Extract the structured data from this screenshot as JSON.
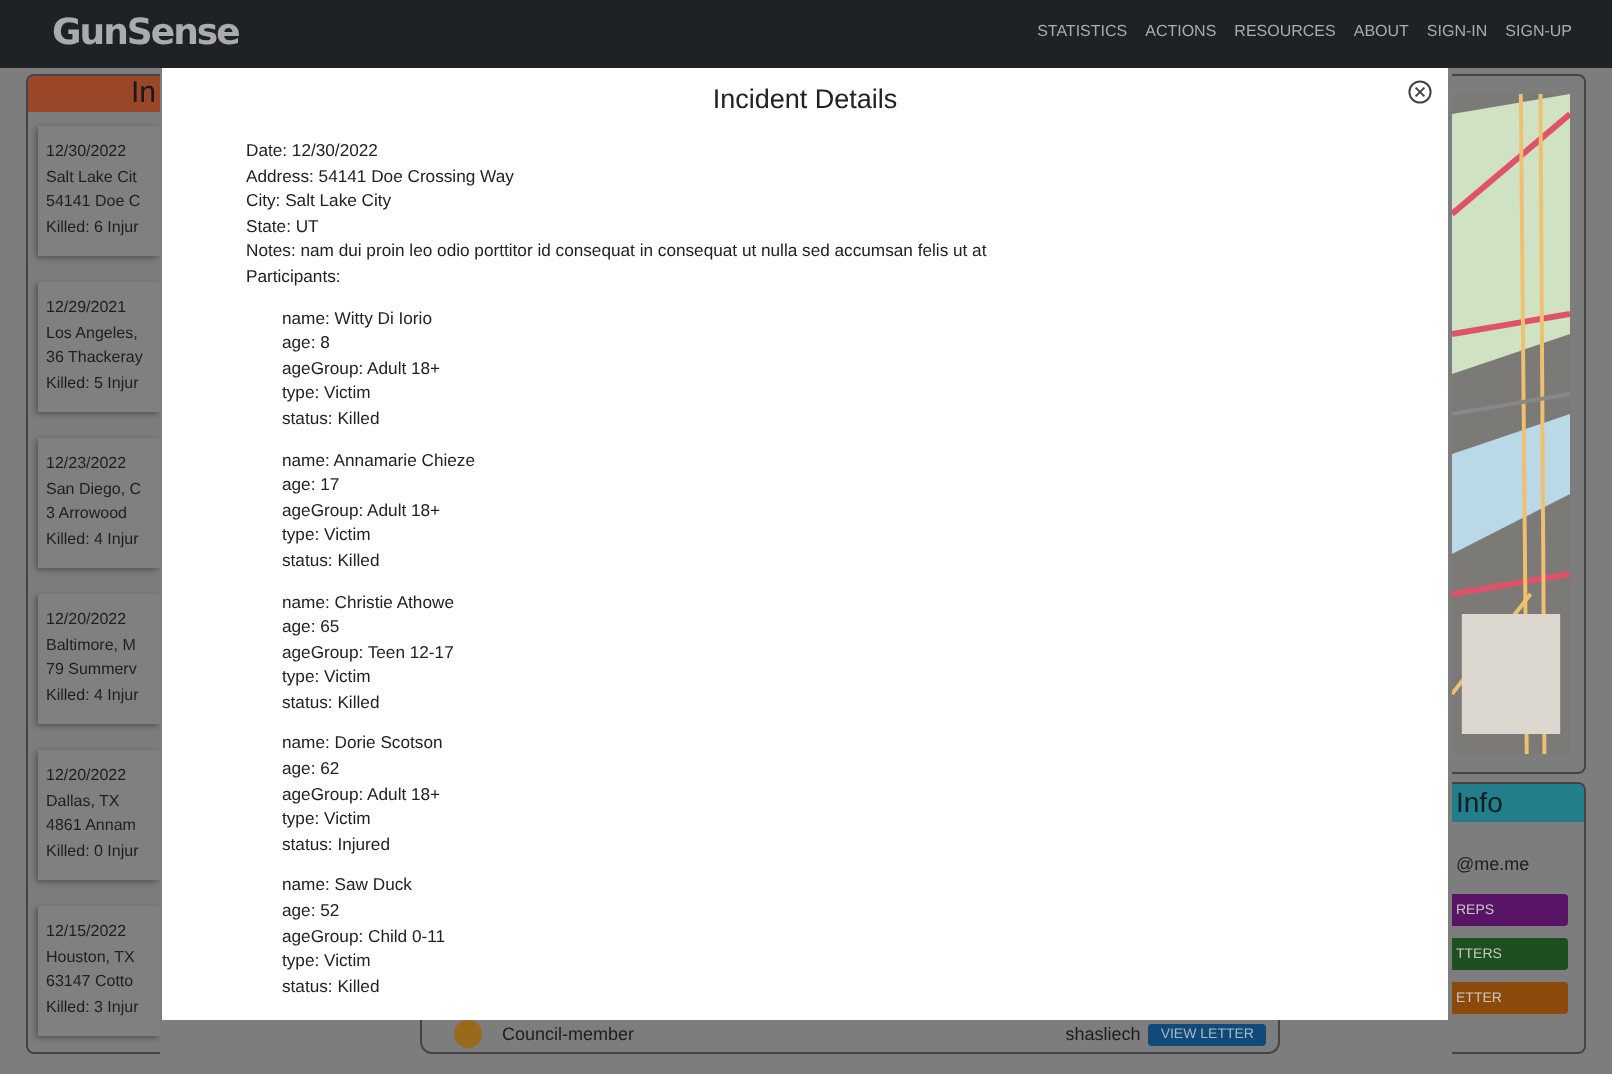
{
  "header": {
    "logo": "GunSense",
    "nav": [
      "STATISTICS",
      "ACTIONS",
      "RESOURCES",
      "ABOUT",
      "SIGN-IN",
      "SIGN-UP"
    ]
  },
  "incidents_panel": {
    "title": "In",
    "cards": [
      {
        "lines": [
          "12/30/2022",
          "Salt Lake Cit",
          "54141 Doe C",
          "Killed: 6 Injur"
        ]
      },
      {
        "lines": [
          "12/29/2021",
          "Los Angeles,",
          "36 Thackeray",
          "Killed: 5 Injur"
        ]
      },
      {
        "lines": [
          "12/23/2022",
          "San Diego, C",
          "3 Arrowood",
          "Killed: 4 Injur"
        ]
      },
      {
        "lines": [
          "12/20/2022",
          "Baltimore, M",
          "79 Summerv",
          "Killed: 4 Injur"
        ]
      },
      {
        "lines": [
          "12/20/2022",
          "Dallas, TX",
          "4861 Annam",
          "Killed: 0 Injur"
        ]
      },
      {
        "lines": [
          "12/15/2022",
          "Houston, TX",
          "63147 Cotto",
          "Killed: 3 Injur"
        ]
      }
    ]
  },
  "reps_row": {
    "role": "Council-member",
    "email": "shasliech",
    "button": "VIEW LETTER"
  },
  "info_panel": {
    "title": "Info",
    "email": "@me.me",
    "buttons": [
      {
        "label": "REPS",
        "color": "#5a1466"
      },
      {
        "label": "TTERS",
        "color": "#1d4f20"
      },
      {
        "label": "ETTER",
        "color": "#8c4a0a"
      }
    ]
  },
  "modal": {
    "title": "Incident Details",
    "details": [
      "Date: 12/30/2022",
      "Address: 54141 Doe Crossing Way",
      "City: Salt Lake City",
      "State: UT",
      "Notes: nam dui proin leo odio porttitor id consequat in consequat ut nulla sed accumsan felis ut at",
      "Participants:"
    ],
    "participants": [
      {
        "lines": [
          "name: Witty Di Iorio",
          "age: 8",
          "ageGroup: Adult 18+",
          "type: Victim",
          "status: Killed"
        ]
      },
      {
        "lines": [
          "name: Annamarie Chieze",
          "age: 17",
          "ageGroup: Adult 18+",
          "type: Victim",
          "status: Killed"
        ]
      },
      {
        "lines": [
          "name: Christie Athowe",
          "age: 65",
          "ageGroup: Teen 12-17",
          "type: Victim",
          "status: Killed"
        ]
      },
      {
        "lines": [
          "name: Dorie Scotson",
          "age: 62",
          "ageGroup: Adult 18+",
          "type: Victim",
          "status: Injured"
        ]
      },
      {
        "lines": [
          "name: Saw Duck",
          "age: 52",
          "ageGroup: Child 0-11",
          "type: Victim",
          "status: Killed"
        ]
      }
    ]
  }
}
